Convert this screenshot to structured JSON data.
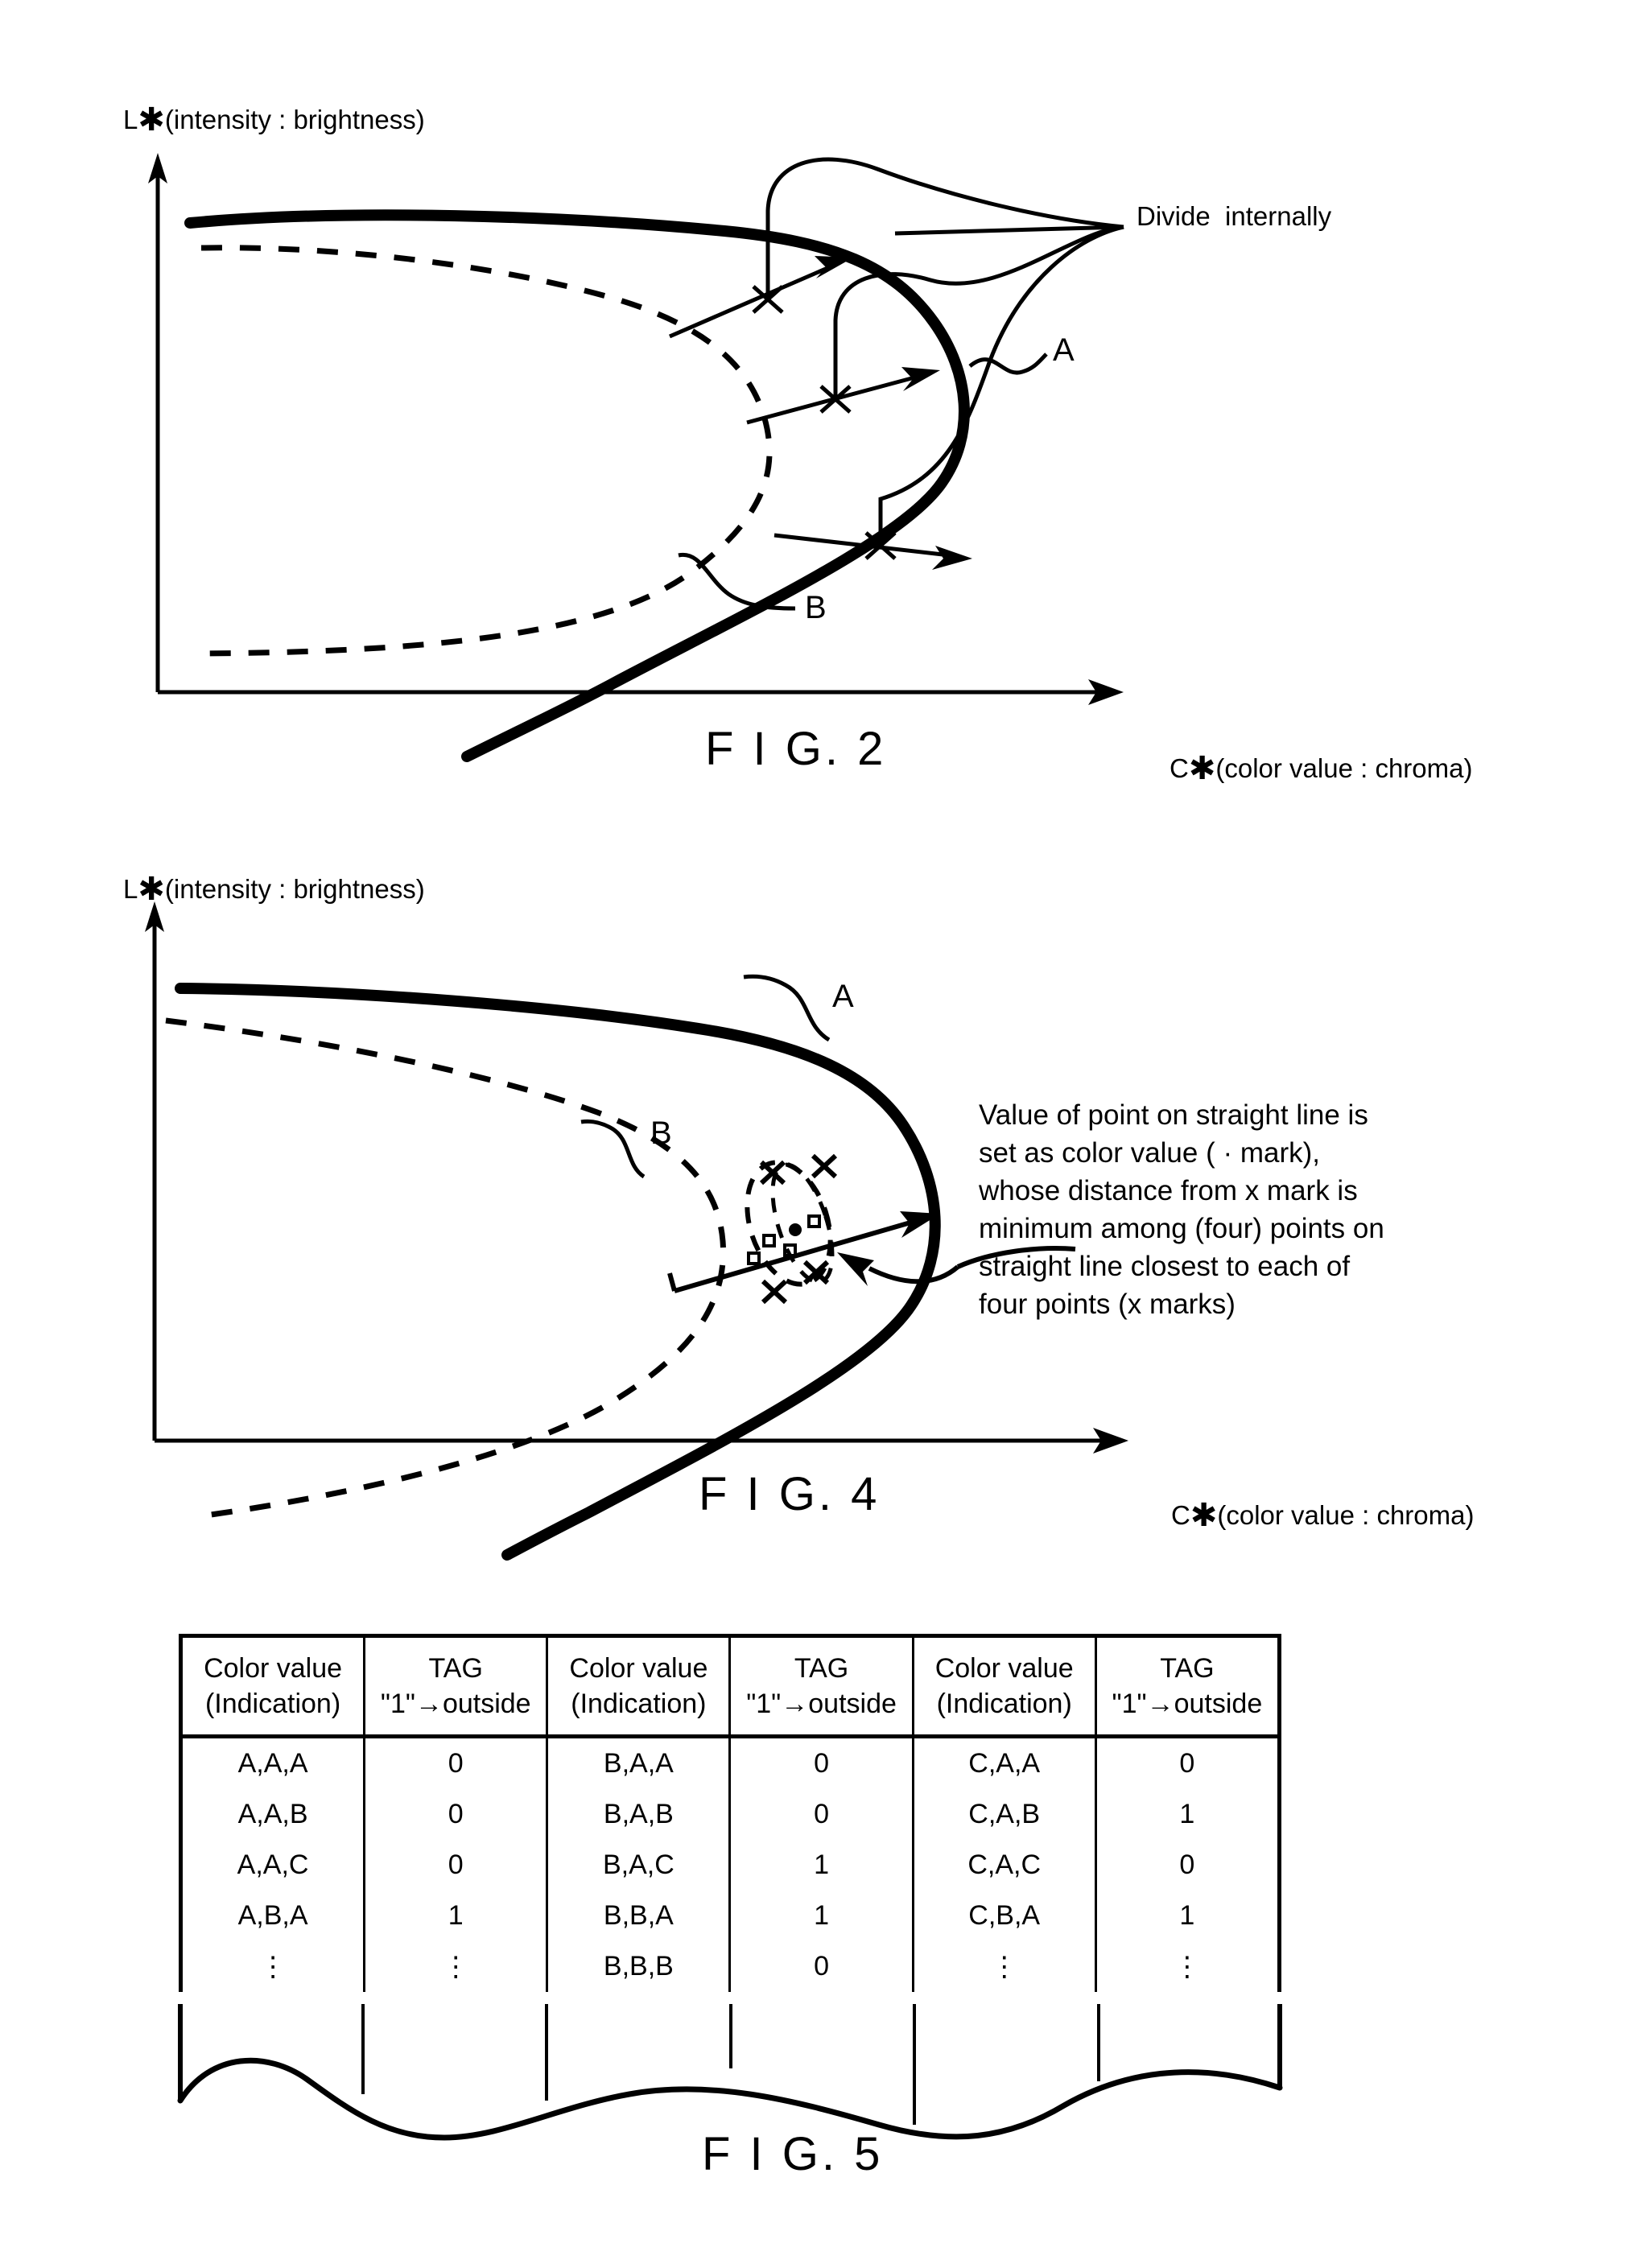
{
  "figures": [
    {
      "id": "fig2",
      "caption": "F I G. 2",
      "y_axis_label": "L✱(intensity : brightness)",
      "y_axis_label_main": "L",
      "y_axis_label_rest": "(intensity : brightness)",
      "x_axis_label_main": "C",
      "x_axis_label_rest": "(color value : chroma)",
      "curve_labels": {
        "outer": "A",
        "inner": "B"
      },
      "annotation": "Divide  internally",
      "marks": "x marks on mapping lines"
    },
    {
      "id": "fig4",
      "caption": "F I G. 4",
      "y_axis_label_main": "L",
      "y_axis_label_rest": "(intensity : brightness)",
      "x_axis_label_main": "C",
      "x_axis_label_rest": "(color value : chroma)",
      "curve_labels": {
        "outer": "A",
        "inner": "B"
      },
      "annotation": "Value of point on straight line is\nset as color value ( · mark),\nwhose distance from x mark is\nminimum among (four) points on\nstraight line closest to each of\nfour points (x marks)"
    },
    {
      "id": "fig5",
      "caption": "F I G. 5"
    }
  ],
  "table": {
    "headers": [
      {
        "line1": "Color value",
        "line2": "(Indication)"
      },
      {
        "line1": "TAG",
        "line2": "\"1\"→outside"
      },
      {
        "line1": "Color value",
        "line2": "(Indication)"
      },
      {
        "line1": "TAG",
        "line2": "\"1\"→outside"
      },
      {
        "line1": "Color value",
        "line2": "(Indication)"
      },
      {
        "line1": "TAG",
        "line2": "\"1\"→outside"
      }
    ],
    "rows": [
      [
        "A,A,A",
        "0",
        "B,A,A",
        "0",
        "C,A,A",
        "0"
      ],
      [
        "A,A,B",
        "0",
        "B,A,B",
        "0",
        "C,A,B",
        "1"
      ],
      [
        "A,A,C",
        "0",
        "B,A,C",
        "1",
        "C,A,C",
        "0"
      ],
      [
        "A,B,A",
        "1",
        "B,B,A",
        "1",
        "C,B,A",
        "1"
      ],
      [
        "⋮",
        "⋮",
        "B,B,B",
        "0",
        "⋮",
        "⋮"
      ]
    ]
  },
  "colors": {
    "ink": "#000000",
    "paper": "#ffffff"
  }
}
